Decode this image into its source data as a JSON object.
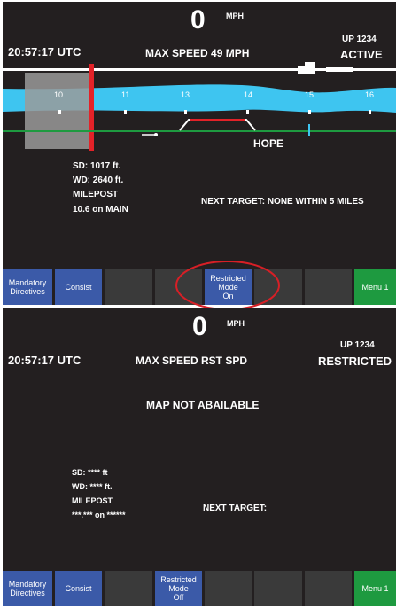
{
  "top": {
    "speed": "0",
    "speed_unit": "MPH",
    "time": "20:57:17 UTC",
    "max_speed": "MAX SPEED 49 MPH",
    "loco_id": "UP 1234",
    "mode_status": "ACTIVE",
    "mileposts": [
      "10",
      "11",
      "13",
      "14",
      "15",
      "16"
    ],
    "station": "HOPE",
    "sd": "SD:  1017 ft.",
    "wd": "WD:  2640 ft.",
    "milepost_label": "MILEPOST",
    "milepost_value": "10.6 on MAIN",
    "next_target": "NEXT TARGET: NONE WITHIN 5 MILES",
    "buttons": {
      "mandatory": "Mandatory\nDirectives",
      "consist": "Consist",
      "restricted": "Restricted\nMode\nOn",
      "menu": "Menu 1"
    }
  },
  "bottom": {
    "speed": "0",
    "speed_unit": "MPH",
    "time": "20:57:17 UTC",
    "max_speed": "MAX SPEED RST SPD",
    "loco_id": "UP 1234",
    "mode_status": "RESTRICTED",
    "map_message": "MAP NOT ABAILABLE",
    "sd": "SD:  **** ft",
    "wd": "WD:  **** ft.",
    "milepost_label": "MILEPOST",
    "milepost_value": "***.*** on ******",
    "next_target": "NEXT TARGET:",
    "buttons": {
      "mandatory": "Mandatory\nDirectives",
      "consist": "Consist",
      "restricted": "Restricted\nMode\nOff",
      "menu": "Menu 1"
    }
  },
  "colors": {
    "screen_bg": "#231f20",
    "track_blue": "#3ec5f0",
    "button_blue": "#3b5aa8",
    "button_green": "#1e9a40",
    "position_red": "#e32228",
    "ground_green": "#1e9a40",
    "highlight_circle": "#d71f26"
  }
}
